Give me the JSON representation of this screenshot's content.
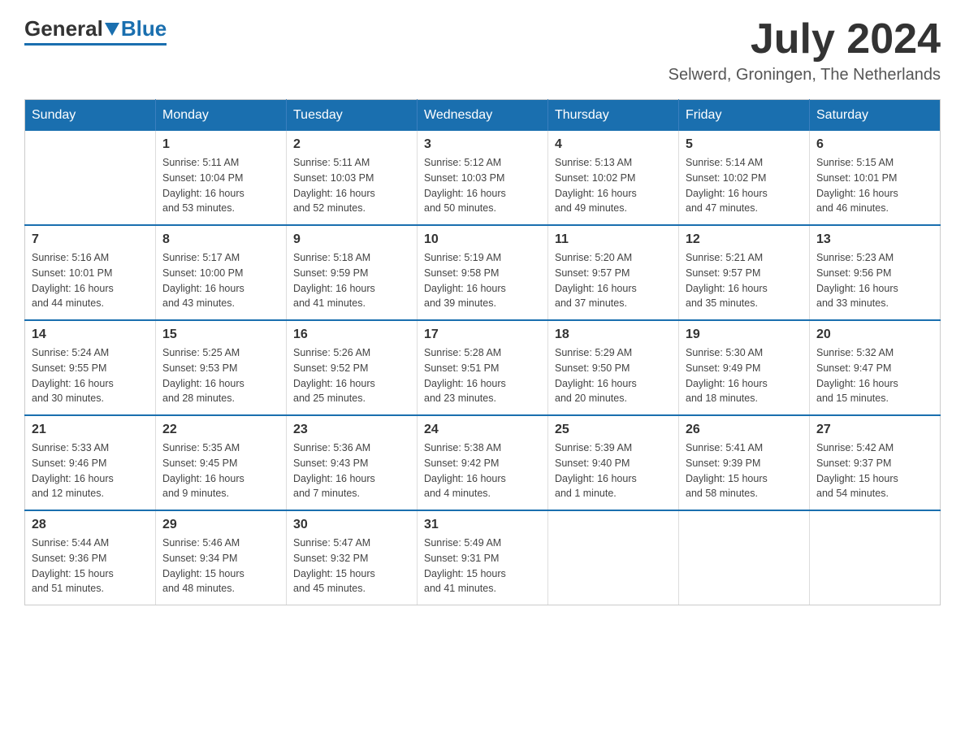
{
  "header": {
    "logo_general": "General",
    "logo_blue": "Blue",
    "month_year": "July 2024",
    "location": "Selwerd, Groningen, The Netherlands"
  },
  "calendar": {
    "days_of_week": [
      "Sunday",
      "Monday",
      "Tuesday",
      "Wednesday",
      "Thursday",
      "Friday",
      "Saturday"
    ],
    "weeks": [
      [
        {
          "day": "",
          "info": ""
        },
        {
          "day": "1",
          "info": "Sunrise: 5:11 AM\nSunset: 10:04 PM\nDaylight: 16 hours\nand 53 minutes."
        },
        {
          "day": "2",
          "info": "Sunrise: 5:11 AM\nSunset: 10:03 PM\nDaylight: 16 hours\nand 52 minutes."
        },
        {
          "day": "3",
          "info": "Sunrise: 5:12 AM\nSunset: 10:03 PM\nDaylight: 16 hours\nand 50 minutes."
        },
        {
          "day": "4",
          "info": "Sunrise: 5:13 AM\nSunset: 10:02 PM\nDaylight: 16 hours\nand 49 minutes."
        },
        {
          "day": "5",
          "info": "Sunrise: 5:14 AM\nSunset: 10:02 PM\nDaylight: 16 hours\nand 47 minutes."
        },
        {
          "day": "6",
          "info": "Sunrise: 5:15 AM\nSunset: 10:01 PM\nDaylight: 16 hours\nand 46 minutes."
        }
      ],
      [
        {
          "day": "7",
          "info": "Sunrise: 5:16 AM\nSunset: 10:01 PM\nDaylight: 16 hours\nand 44 minutes."
        },
        {
          "day": "8",
          "info": "Sunrise: 5:17 AM\nSunset: 10:00 PM\nDaylight: 16 hours\nand 43 minutes."
        },
        {
          "day": "9",
          "info": "Sunrise: 5:18 AM\nSunset: 9:59 PM\nDaylight: 16 hours\nand 41 minutes."
        },
        {
          "day": "10",
          "info": "Sunrise: 5:19 AM\nSunset: 9:58 PM\nDaylight: 16 hours\nand 39 minutes."
        },
        {
          "day": "11",
          "info": "Sunrise: 5:20 AM\nSunset: 9:57 PM\nDaylight: 16 hours\nand 37 minutes."
        },
        {
          "day": "12",
          "info": "Sunrise: 5:21 AM\nSunset: 9:57 PM\nDaylight: 16 hours\nand 35 minutes."
        },
        {
          "day": "13",
          "info": "Sunrise: 5:23 AM\nSunset: 9:56 PM\nDaylight: 16 hours\nand 33 minutes."
        }
      ],
      [
        {
          "day": "14",
          "info": "Sunrise: 5:24 AM\nSunset: 9:55 PM\nDaylight: 16 hours\nand 30 minutes."
        },
        {
          "day": "15",
          "info": "Sunrise: 5:25 AM\nSunset: 9:53 PM\nDaylight: 16 hours\nand 28 minutes."
        },
        {
          "day": "16",
          "info": "Sunrise: 5:26 AM\nSunset: 9:52 PM\nDaylight: 16 hours\nand 25 minutes."
        },
        {
          "day": "17",
          "info": "Sunrise: 5:28 AM\nSunset: 9:51 PM\nDaylight: 16 hours\nand 23 minutes."
        },
        {
          "day": "18",
          "info": "Sunrise: 5:29 AM\nSunset: 9:50 PM\nDaylight: 16 hours\nand 20 minutes."
        },
        {
          "day": "19",
          "info": "Sunrise: 5:30 AM\nSunset: 9:49 PM\nDaylight: 16 hours\nand 18 minutes."
        },
        {
          "day": "20",
          "info": "Sunrise: 5:32 AM\nSunset: 9:47 PM\nDaylight: 16 hours\nand 15 minutes."
        }
      ],
      [
        {
          "day": "21",
          "info": "Sunrise: 5:33 AM\nSunset: 9:46 PM\nDaylight: 16 hours\nand 12 minutes."
        },
        {
          "day": "22",
          "info": "Sunrise: 5:35 AM\nSunset: 9:45 PM\nDaylight: 16 hours\nand 9 minutes."
        },
        {
          "day": "23",
          "info": "Sunrise: 5:36 AM\nSunset: 9:43 PM\nDaylight: 16 hours\nand 7 minutes."
        },
        {
          "day": "24",
          "info": "Sunrise: 5:38 AM\nSunset: 9:42 PM\nDaylight: 16 hours\nand 4 minutes."
        },
        {
          "day": "25",
          "info": "Sunrise: 5:39 AM\nSunset: 9:40 PM\nDaylight: 16 hours\nand 1 minute."
        },
        {
          "day": "26",
          "info": "Sunrise: 5:41 AM\nSunset: 9:39 PM\nDaylight: 15 hours\nand 58 minutes."
        },
        {
          "day": "27",
          "info": "Sunrise: 5:42 AM\nSunset: 9:37 PM\nDaylight: 15 hours\nand 54 minutes."
        }
      ],
      [
        {
          "day": "28",
          "info": "Sunrise: 5:44 AM\nSunset: 9:36 PM\nDaylight: 15 hours\nand 51 minutes."
        },
        {
          "day": "29",
          "info": "Sunrise: 5:46 AM\nSunset: 9:34 PM\nDaylight: 15 hours\nand 48 minutes."
        },
        {
          "day": "30",
          "info": "Sunrise: 5:47 AM\nSunset: 9:32 PM\nDaylight: 15 hours\nand 45 minutes."
        },
        {
          "day": "31",
          "info": "Sunrise: 5:49 AM\nSunset: 9:31 PM\nDaylight: 15 hours\nand 41 minutes."
        },
        {
          "day": "",
          "info": ""
        },
        {
          "day": "",
          "info": ""
        },
        {
          "day": "",
          "info": ""
        }
      ]
    ]
  }
}
